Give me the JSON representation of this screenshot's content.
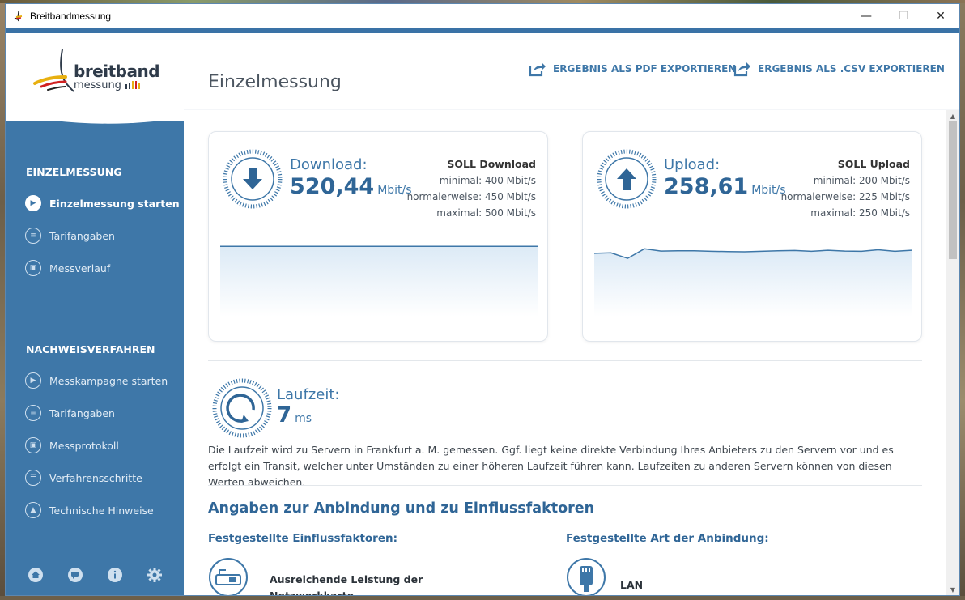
{
  "window": {
    "title": "Breitbandmessung",
    "min": "—",
    "max": "☐",
    "close": "✕"
  },
  "logo": {
    "line1": "breitband",
    "line2": "messung"
  },
  "sidebar": {
    "section1": "EINZELMESSUNG",
    "items1": [
      {
        "label": "Einzelmessung starten",
        "icon": "play-icon",
        "active": true
      },
      {
        "label": "Tarifangaben",
        "icon": "tariff-icon"
      },
      {
        "label": "Messverlauf",
        "icon": "history-icon"
      }
    ],
    "section2": "NACHWEISVERFAHREN",
    "items2": [
      {
        "label": "Messkampagne starten",
        "icon": "play-icon"
      },
      {
        "label": "Tarifangaben",
        "icon": "tariff-icon"
      },
      {
        "label": "Messprotokoll",
        "icon": "protocol-icon"
      },
      {
        "label": "Verfahrensschritte",
        "icon": "steps-icon"
      },
      {
        "label": "Technische Hinweise",
        "icon": "warning-icon"
      }
    ],
    "bottom_icons": [
      "home-icon",
      "chat-icon",
      "info-icon",
      "gear-icon"
    ]
  },
  "header": {
    "title": "Einzelmessung",
    "export_pdf": "ERGEBNIS ALS PDF EXPORTIEREN",
    "export_csv": "ERGEBNIS ALS .CSV EXPORTIEREN"
  },
  "download": {
    "label": "Download:",
    "value": "520,44",
    "unit": "Mbit/s",
    "soll_title": "SOLL Download",
    "min": "minimal: 400 Mbit/s",
    "normal": "normalerweise: 450 Mbit/s",
    "max": "maximal: 500 Mbit/s",
    "series": [
      520.4,
      520.4,
      520.3,
      520.5,
      520.4,
      520.4,
      520.3,
      520.4,
      520.5,
      520.4,
      520.4,
      520.4,
      520.4,
      520.4,
      520.4,
      520.4,
      520.4,
      520.4,
      520.4,
      520.4
    ]
  },
  "upload": {
    "label": "Upload:",
    "value": "258,61",
    "unit": "Mbit/s",
    "soll_title": "SOLL Upload",
    "min": "minimal: 200 Mbit/s",
    "normal": "normalerweise: 225 Mbit/s",
    "max": "maximal: 250 Mbit/s",
    "series": [
      250,
      252,
      230,
      268,
      259,
      260,
      260,
      258,
      257,
      256,
      258,
      260,
      261,
      258,
      262,
      259,
      258,
      264,
      258,
      262
    ]
  },
  "latency": {
    "label": "Laufzeit:",
    "value": "7",
    "unit": "ms",
    "note": "Die Laufzeit wird zu Servern in Frankfurt a. M. gemessen. Ggf. liegt keine direkte Verbindung Ihres Anbieters zu den Servern vor und es erfolgt ein Transit, welcher unter Umständen zu einer höheren Laufzeit führen kann. Laufzeiten zu anderen Servern können von diesen Werten abweichen."
  },
  "connection": {
    "heading": "Angaben zur Anbindung und zu Einflussfaktoren",
    "factors_heading": "Festgestellte Einflussfaktoren:",
    "type_heading": "Festgestellte Art der Anbindung:",
    "factor_text": "Ausreichende Leistung der Netzwerkkarte",
    "type_text": "LAN"
  },
  "colors": {
    "primary": "#3e77a8",
    "dark_primary": "#2f6596",
    "chart_fill": "#dceaf6"
  }
}
